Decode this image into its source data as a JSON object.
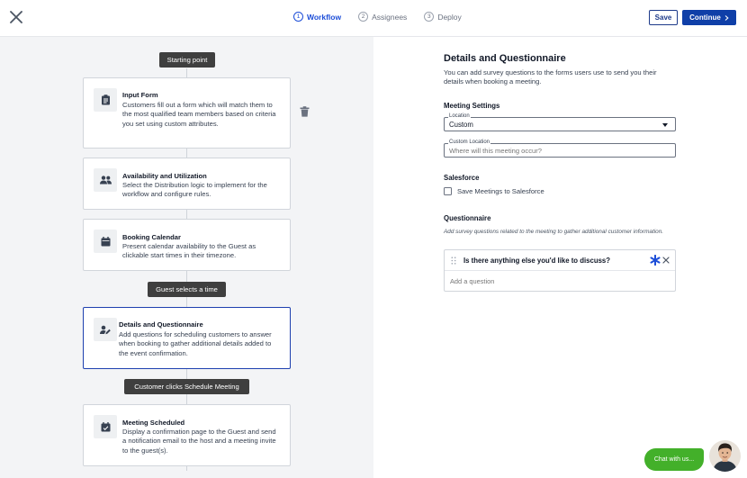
{
  "topbar": {
    "steps": [
      {
        "num": "1",
        "label": "Workflow",
        "active": true
      },
      {
        "num": "2",
        "label": "Assignees",
        "active": false
      },
      {
        "num": "3",
        "label": "Deploy",
        "active": false
      }
    ],
    "save_label": "Save",
    "continue_label": "Continue"
  },
  "workflow": {
    "pills": {
      "start": "Starting point",
      "guest_selects": "Guest selects a time",
      "customer_clicks": "Customer clicks Schedule Meeting"
    },
    "cards": [
      {
        "title": "Input Form",
        "description": "Customers fill out a form which will match them to the most qualified team members based on criteria you set using custom attributes.",
        "icon": "clipboard-icon"
      },
      {
        "title": "Availability and Utilization",
        "description": "Select the Distribution logic to implement for the workflow and configure rules.",
        "icon": "people-icon"
      },
      {
        "title": "Booking Calendar",
        "description": "Present calendar availability to the Guest as clickable start times in their timezone.",
        "icon": "calendar-icon"
      },
      {
        "title": "Details and Questionnaire",
        "description": "Add questions for scheduling customers to answer when booking to gather additional details added to the event confirmation.",
        "icon": "person-edit-icon",
        "selected": true
      },
      {
        "title": "Meeting Scheduled",
        "description": "Display a confirmation page to the Guest and send a notification email to the host and a meeting invite to the guest(s).",
        "icon": "calendar-check-icon"
      }
    ]
  },
  "details": {
    "title": "Details and Questionnaire",
    "subtitle": "You can add survey questions to the forms users use to send you their details when booking a meeting.",
    "meeting_settings": {
      "heading": "Meeting Settings",
      "location_label": "Location",
      "location_value": "Custom",
      "custom_location_label": "Custom Location",
      "custom_location_placeholder": "Where will this meeting occur?"
    },
    "salesforce": {
      "heading": "Salesforce",
      "checkbox_label": "Save Meetings to Salesforce",
      "checked": false
    },
    "questionnaire": {
      "heading": "Questionnaire",
      "hint": "Add survey questions related to the meeting to gather additional customer information.",
      "questions": [
        "Is there anything else you'd like to discuss?"
      ],
      "add_placeholder": "Add a question"
    }
  },
  "chat": {
    "label": "Chat with us..."
  },
  "colors": {
    "primary": "#0f3fa8",
    "accent_blue": "#1d4ed8",
    "chat_green": "#43b02a",
    "pane_bg": "#f3f4f6"
  }
}
